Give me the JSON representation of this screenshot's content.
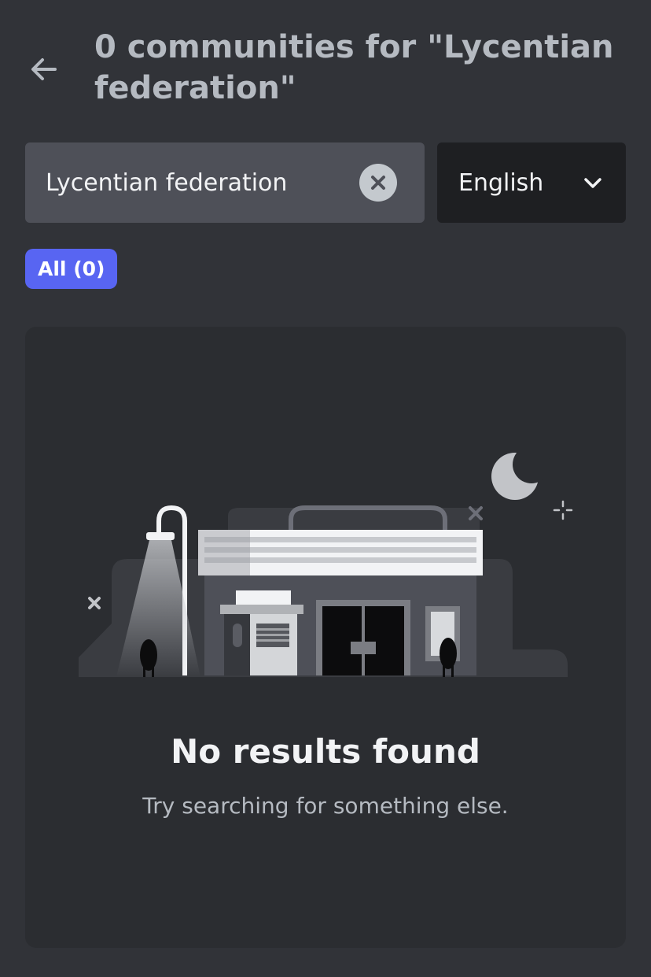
{
  "header": {
    "title": "0 communities for \"Lycentian federation\"",
    "back_icon": "arrow-left-icon"
  },
  "search": {
    "value": "Lycentian federation",
    "clear_icon": "close-circle-icon"
  },
  "language": {
    "selected": "English",
    "icon": "chevron-down-icon"
  },
  "filters": [
    {
      "label": "All (0)",
      "active": true
    }
  ],
  "empty_state": {
    "title": "No results found",
    "subtitle": "Try searching for something else."
  },
  "colors": {
    "background": "#313338",
    "card": "#2b2d31",
    "input": "#4e5058",
    "select": "#1e1f22",
    "accent": "#5865f2"
  }
}
